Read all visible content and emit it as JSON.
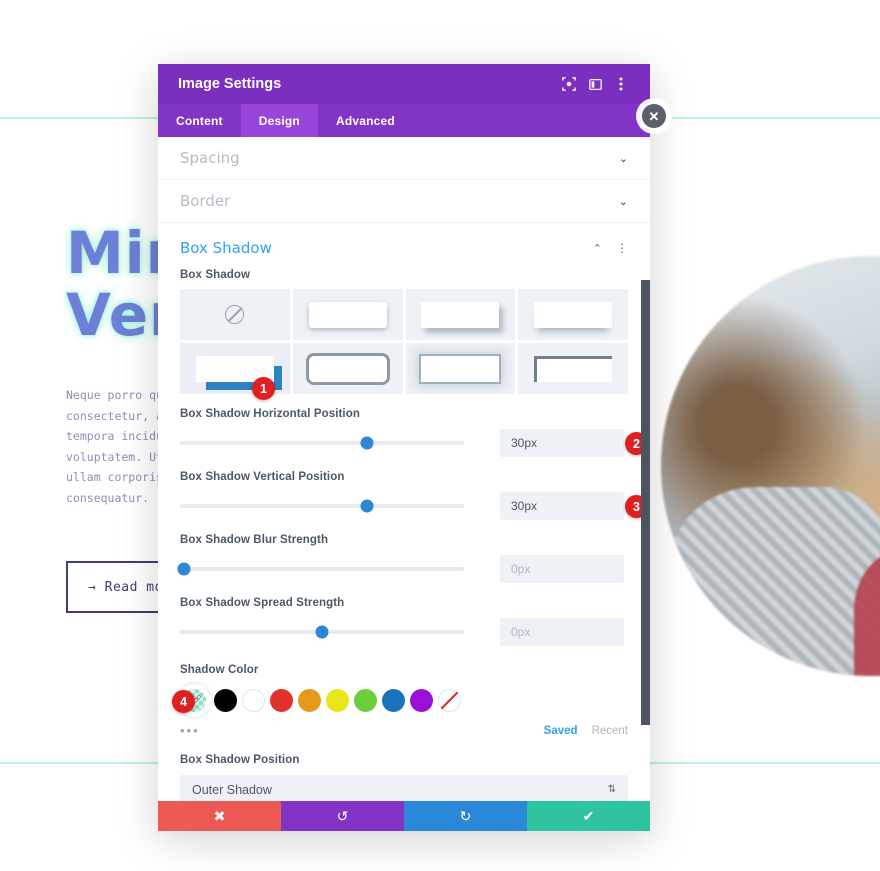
{
  "background": {
    "heading": "Min\nVer",
    "body_text": "Neque porro qui\nconsectetur, ad\ntempora incidun\nvoluptatem. Ut\nullam corporis\nconsequatur.",
    "read_more_label": "→ Read more",
    "close_icon": "✕"
  },
  "modal": {
    "title": "Image Settings",
    "header_icons": [
      {
        "name": "focus-target-icon",
        "glyph": "◉"
      },
      {
        "name": "split-view-icon",
        "glyph": "▥"
      },
      {
        "name": "kebab-menu-icon",
        "glyph": "⋮"
      }
    ],
    "tabs": [
      {
        "label": "Content",
        "active": false
      },
      {
        "label": "Design",
        "active": true
      },
      {
        "label": "Advanced",
        "active": false
      }
    ],
    "collapsed_sections": [
      {
        "label": "Spacing",
        "chevron": "⌄"
      },
      {
        "label": "Border",
        "chevron": "⌄"
      }
    ],
    "box_shadow_section": {
      "title": "Box Shadow",
      "collapse_chevron": "⌃",
      "kebab": "⋮",
      "preset_label": "Box Shadow",
      "presets": [
        {
          "name": "none",
          "selected": false
        },
        {
          "name": "soft-bottom",
          "selected": false
        },
        {
          "name": "offset-bottom-right",
          "selected": false
        },
        {
          "name": "wide-bottom",
          "selected": false
        },
        {
          "name": "solid-offset-blue",
          "selected": true
        },
        {
          "name": "outline-rounded",
          "selected": false
        },
        {
          "name": "glow-outline",
          "selected": false
        },
        {
          "name": "top-left-border",
          "selected": false
        }
      ],
      "sliders": [
        {
          "label": "Box Shadow Horizontal Position",
          "value": "30px",
          "percent": 66,
          "muted": false
        },
        {
          "label": "Box Shadow Vertical Position",
          "value": "30px",
          "percent": 66,
          "muted": false
        },
        {
          "label": "Box Shadow Blur Strength",
          "value": "0px",
          "percent": 1,
          "muted": true
        },
        {
          "label": "Box Shadow Spread Strength",
          "value": "0px",
          "percent": 50,
          "muted": true
        }
      ],
      "shadow_color": {
        "label": "Shadow Color",
        "selected_swatch": "eyedropper-transparent",
        "swatches": [
          {
            "name": "eyedropper",
            "color": "#8fdfc8",
            "selected": true
          },
          {
            "name": "black",
            "color": "#000000",
            "selected": false
          },
          {
            "name": "white",
            "color": "#ffffff",
            "selected": false
          },
          {
            "name": "red",
            "color": "#e0332e",
            "selected": false
          },
          {
            "name": "orange",
            "color": "#e79a1a",
            "selected": false
          },
          {
            "name": "yellow",
            "color": "#ede51c",
            "selected": false
          },
          {
            "name": "green",
            "color": "#6dce3b",
            "selected": false
          },
          {
            "name": "blue",
            "color": "#1a72bd",
            "selected": false
          },
          {
            "name": "purple",
            "color": "#9b10d6",
            "selected": false
          },
          {
            "name": "transparent",
            "color": "#ffffff",
            "selected": false
          }
        ],
        "more_dots": "•••",
        "saved_label": "Saved",
        "recent_label": "Recent"
      },
      "position": {
        "label": "Box Shadow Position",
        "value": "Outer Shadow",
        "arrows": "⇅"
      }
    },
    "footer_buttons": [
      {
        "name": "cancel",
        "glyph": "✖",
        "color": "#eb5a55"
      },
      {
        "name": "undo",
        "glyph": "↺",
        "color": "#8234c6"
      },
      {
        "name": "redo",
        "glyph": "↻",
        "color": "#2b87d8"
      },
      {
        "name": "save",
        "glyph": "✔",
        "color": "#2ec4a0"
      }
    ]
  },
  "callouts": [
    {
      "number": "1",
      "target": "selected-box-shadow-preset"
    },
    {
      "number": "2",
      "target": "horizontal-position-value"
    },
    {
      "number": "3",
      "target": "vertical-position-value"
    },
    {
      "number": "4",
      "target": "shadow-color-swatch"
    }
  ]
}
